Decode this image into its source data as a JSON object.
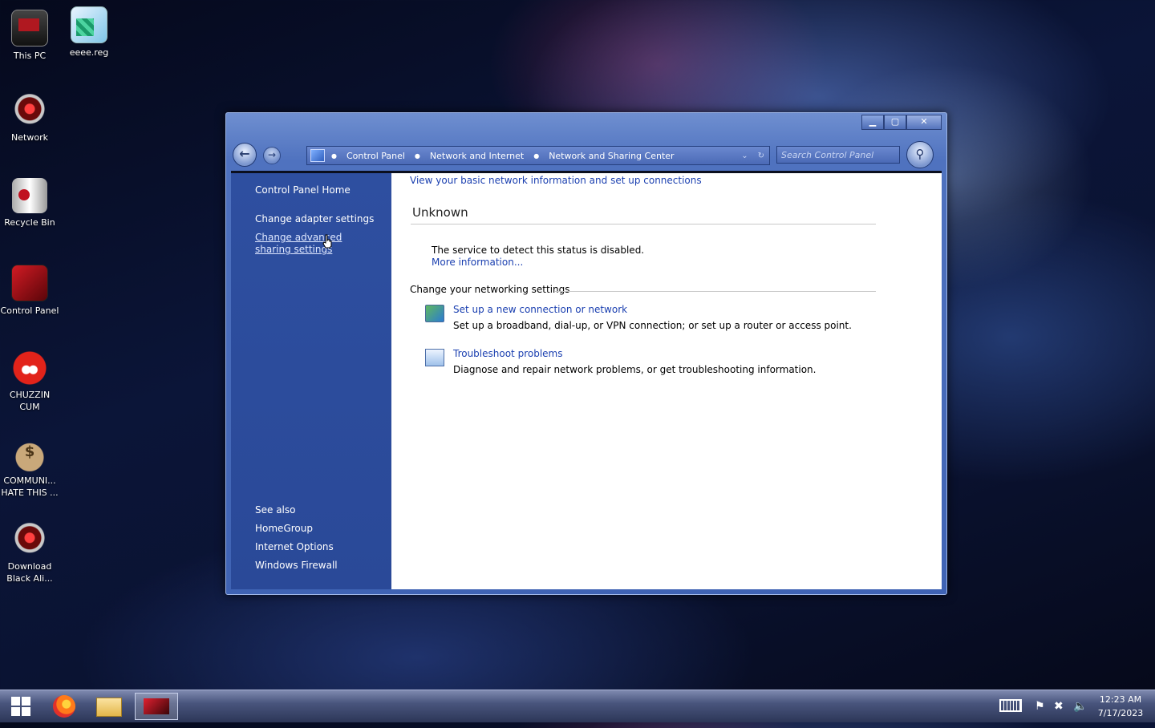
{
  "desktop": {
    "icons": [
      {
        "label": "This PC",
        "icon": "this-pc-icon"
      },
      {
        "label": "eeee.reg",
        "icon": "registry-file-icon"
      },
      {
        "label": "Network",
        "icon": "network-icon"
      },
      {
        "label": "Recycle Bin",
        "icon": "recycle-bin-icon"
      },
      {
        "label": "Control Panel",
        "icon": "control-panel-icon"
      },
      {
        "label": "CHUZZIN CUM",
        "icon": "chuzzle-icon"
      },
      {
        "label": "COMMUNI... HATE THIS ...",
        "icon": "money-bag-icon"
      },
      {
        "label": "Download Black Ali...",
        "icon": "download-icon"
      }
    ]
  },
  "window": {
    "controls": {
      "minimize": "▁",
      "maximize": "▢",
      "close": "✕"
    },
    "nav": {
      "back": "←",
      "forward": "→"
    },
    "breadcrumb": [
      "Control Panel",
      "Network and Internet",
      "Network and Sharing Center"
    ],
    "address_tail": {
      "dropdown": "⌄",
      "refresh": "↻"
    },
    "search": {
      "placeholder": "Search Control Panel",
      "button_glyph": "⚲"
    },
    "sidebar": {
      "home": "Control Panel Home",
      "links": [
        "Change adapter settings",
        "Change advanced sharing settings"
      ],
      "see_also_title": "See also",
      "see_also": [
        "HomeGroup",
        "Internet Options",
        "Windows Firewall"
      ]
    },
    "main": {
      "header": "View your basic network information and set up connections",
      "network_name": "Unknown",
      "status_text": "The service to detect this status is disabled.",
      "more_info": "More information...",
      "settings_title": "Change your networking settings",
      "tasks": [
        {
          "title": "Set up a new connection or network",
          "desc": "Set up a broadband, dial-up, or VPN connection; or set up a router or access point.",
          "icon": "new-connection-icon"
        },
        {
          "title": "Troubleshoot problems",
          "desc": "Diagnose and repair network problems, or get troubleshooting information.",
          "icon": "troubleshoot-icon"
        }
      ]
    }
  },
  "taskbar": {
    "apps": [
      "start",
      "firefox",
      "file-explorer",
      "control-panel"
    ],
    "tray": {
      "flag": "⚑",
      "network": "✖",
      "volume": "🔈"
    },
    "time": "12:23 AM",
    "date": "7/17/2023"
  }
}
